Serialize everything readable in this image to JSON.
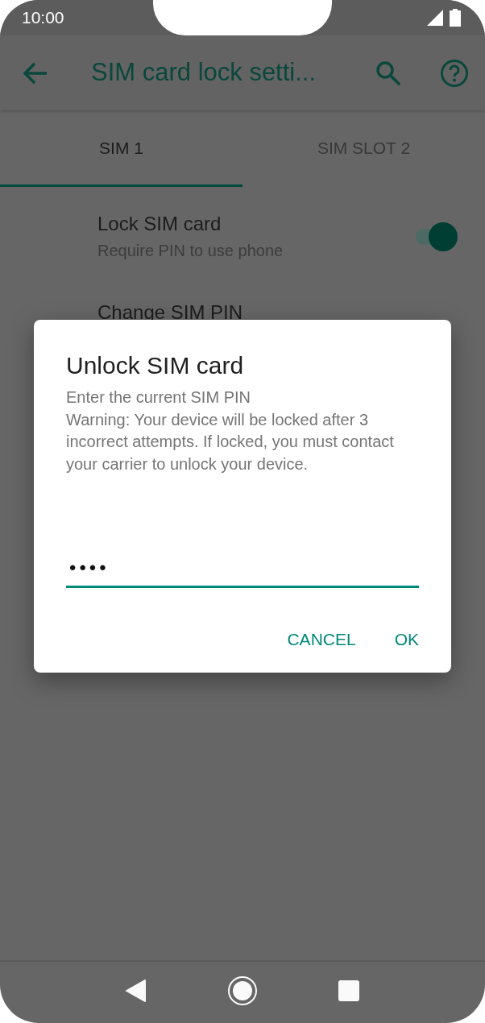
{
  "status_bar": {
    "time": "10:00"
  },
  "toolbar": {
    "title": "SIM card lock setti..."
  },
  "tabs": [
    {
      "label": "SIM 1",
      "selected": true
    },
    {
      "label": "SIM SLOT 2",
      "selected": false
    }
  ],
  "settings": [
    {
      "title": "Lock SIM card",
      "summary": "Require PIN to use phone",
      "on": true
    },
    {
      "title": "Change SIM PIN"
    }
  ],
  "dialog": {
    "title": "Unlock SIM card",
    "message": "Enter the current SIM PIN\nWarning: Your device will be locked after 3 incorrect attempts. If locked, you must contact your carrier to unlock your device.",
    "pin_field": {
      "value": "••••"
    },
    "buttons": [
      "CANCEL",
      "OK"
    ]
  }
}
